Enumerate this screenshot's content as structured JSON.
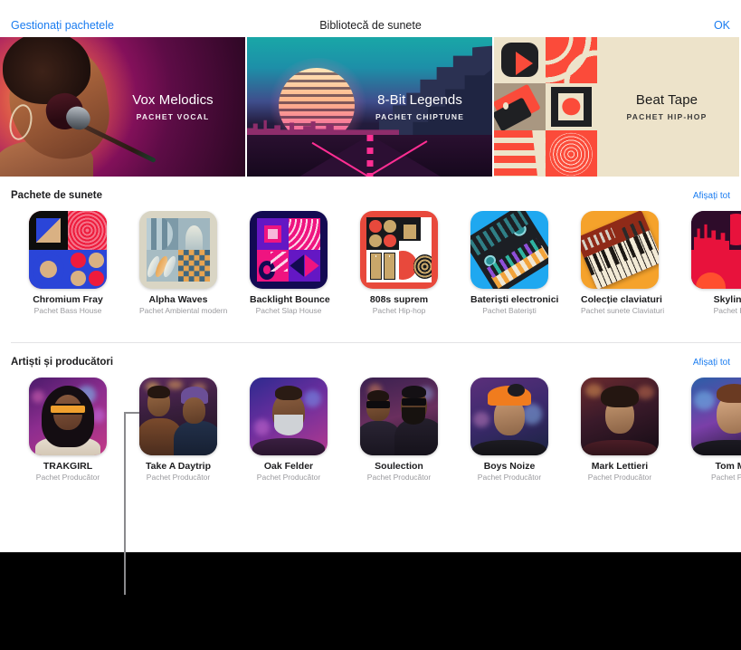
{
  "window": {
    "title": "Bibliotecă de sunete",
    "left_button": "Gestionați pachetele",
    "right_button": "OK",
    "accent_color": "#1a7cf0",
    "background_color": "#ffffff",
    "outside_color": "#000000"
  },
  "heroes": [
    {
      "title": "Vox Melodics",
      "subtitle": "PACHET VOCAL",
      "artwork": "vocal-singer-magenta",
      "text_theme": "light"
    },
    {
      "title": "8-Bit Legends",
      "subtitle": "PACHET CHIPTUNE",
      "artwork": "synthwave-sunset-road",
      "text_theme": "light"
    },
    {
      "title": "Beat Tape",
      "subtitle": "PACHET HIP-HOP",
      "artwork": "geometric-red-cream-grid",
      "text_theme": "dark"
    }
  ],
  "sections": [
    {
      "title": "Pachete de sunete",
      "show_all": "Afișați tot",
      "items": [
        {
          "name": "Chromium Fray",
          "sub": "Pachet Bass House",
          "art": "chromium"
        },
        {
          "name": "Alpha Waves",
          "sub": "Pachet Ambiental modern",
          "art": "alpha"
        },
        {
          "name": "Backlight Bounce",
          "sub": "Pachet Slap House",
          "art": "backlight"
        },
        {
          "name": "808s suprem",
          "sub": "Pachet Hip-hop",
          "art": "s808"
        },
        {
          "name": "Bateriști electronici",
          "sub": "Pachet Bateriști",
          "art": "drums"
        },
        {
          "name": "Colecție claviaturi",
          "sub": "Pachet sunete Claviaturi",
          "art": "keys"
        },
        {
          "name": "Skyline",
          "sub": "Pachet Hi",
          "art": "skyline"
        }
      ]
    },
    {
      "title": "Artiști și producători",
      "show_all": "Afișați tot",
      "items": [
        {
          "name": "TRAKGIRL",
          "sub": "Pachet Producător",
          "art": "trakgirl"
        },
        {
          "name": "Take A Daytrip",
          "sub": "Pachet Producător",
          "art": "daytrip"
        },
        {
          "name": "Oak Felder",
          "sub": "Pachet Producător",
          "art": "oak"
        },
        {
          "name": "Soulection",
          "sub": "Pachet Producător",
          "art": "soulection"
        },
        {
          "name": "Boys Noize",
          "sub": "Pachet Producător",
          "art": "boysnoize"
        },
        {
          "name": "Mark Lettieri",
          "sub": "Pachet Producător",
          "art": "mark"
        },
        {
          "name": "Tom M",
          "sub": "Pachet Pro",
          "art": "tom"
        }
      ]
    }
  ],
  "callout": {
    "name": "annotation-leader-line",
    "color": "#8a8a8d"
  }
}
